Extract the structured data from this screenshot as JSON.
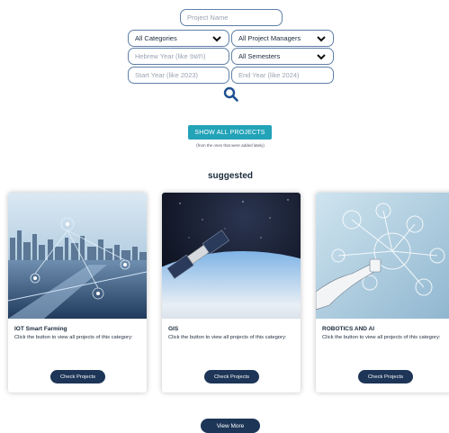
{
  "filters": {
    "project_name_placeholder": "Project Name",
    "category_selected": "All Categories",
    "manager_selected": "All Project Managers",
    "hebrew_year_placeholder": "Hebrew Year (like תשפ)",
    "semester_selected": "All Semesters",
    "start_year_placeholder": "Start Year (like 2023)",
    "end_year_placeholder": "End Year (like 2024)"
  },
  "actions": {
    "show_all_label": "SHOW ALL PROJECTS",
    "show_all_note": "(from the ones that were added lately)"
  },
  "section_title": "suggested",
  "cards": [
    {
      "title": "IOT Smart Farming",
      "description": "Click the button to view all projects of this category:",
      "button": "Check Projects"
    },
    {
      "title": "GIS",
      "description": "Click the button to view all projects of this category:",
      "button": "Check Projects"
    },
    {
      "title": "ROBOTICS AND AI",
      "description": "Click the button to view all projects of this category:",
      "button": "Check Projects"
    }
  ],
  "view_more_label": "View More",
  "colors": {
    "accent": "#22a3b8",
    "dark_button": "#1d3557",
    "field_border": "#5e7fa8"
  }
}
